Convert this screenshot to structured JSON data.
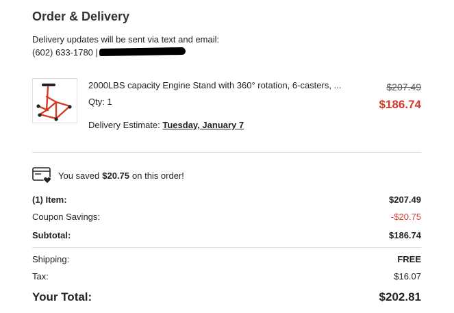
{
  "header": {
    "title": "Order & Delivery",
    "notice": "Delivery updates will be sent via text and email:",
    "phone": "(602) 633-1780 |"
  },
  "item": {
    "name": "2000LBS capacity Engine Stand with 360° rotation, 6-casters, ...",
    "qty": "Qty: 1",
    "original_price": "$207.49",
    "sale_price": "$186.74",
    "delivery_label": "Delivery Estimate:",
    "delivery_date": "Tuesday, January 7",
    "image": "engine-stand-image"
  },
  "savings": {
    "prefix": "You saved",
    "amount": "$20.75",
    "suffix": "on this order!",
    "icon": "card-heart-icon"
  },
  "summary": {
    "items_label": "(1) Item:",
    "items_value": "$207.49",
    "coupon_label": "Coupon Savings:",
    "coupon_value": "-$20.75",
    "subtotal_label": "Subtotal:",
    "subtotal_value": "$186.74",
    "shipping_label": "Shipping:",
    "shipping_value": "FREE",
    "tax_label": "Tax:",
    "tax_value": "$16.07",
    "total_label": "Your Total:",
    "total_value": "$202.81"
  },
  "colors": {
    "accent_red": "#d33a2c",
    "product_orange": "#d63a22",
    "divider": "#d9d9d9"
  }
}
